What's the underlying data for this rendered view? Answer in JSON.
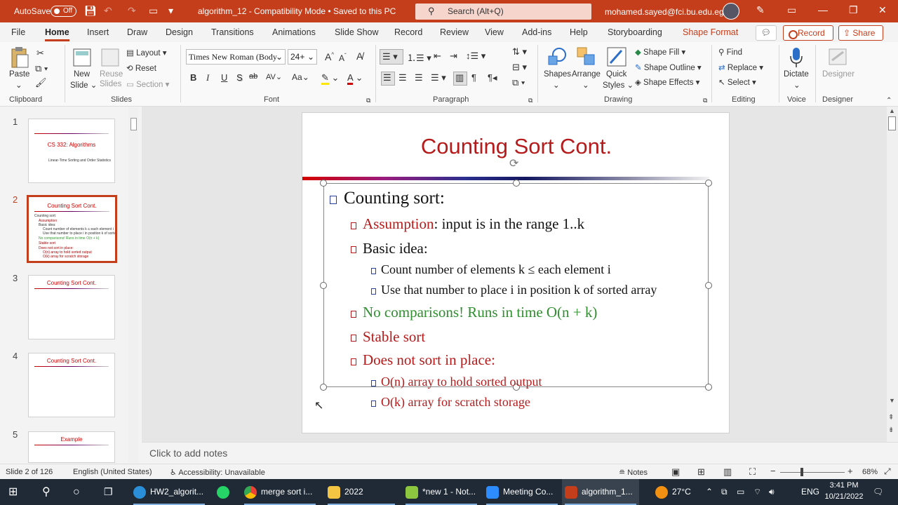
{
  "titlebar": {
    "autosave_label": "AutoSave",
    "autosave_state": "Off",
    "document": "algorithm_12  -  Compatibility Mode  •  Saved to this PC",
    "search_placeholder": "Search (Alt+Q)",
    "user_email": "mohamed.sayed@fci.bu.edu.eg"
  },
  "menu": {
    "tabs": [
      "File",
      "Home",
      "Insert",
      "Draw",
      "Design",
      "Transitions",
      "Animations",
      "Slide Show",
      "Record",
      "Review",
      "View",
      "Add-ins",
      "Help",
      "Storyboarding",
      "Shape Format"
    ],
    "active": "Home",
    "record_label": "Record",
    "share_label": "Share"
  },
  "ribbon": {
    "clipboard": {
      "paste": "Paste",
      "label": "Clipboard"
    },
    "slides": {
      "new_slide": "New",
      "new_slide2": "Slide",
      "reuse": "Reuse",
      "reuse2": "Slides",
      "layout": "Layout",
      "reset": "Reset",
      "section": "Section",
      "label": "Slides"
    },
    "font": {
      "name": "Times New Roman (Body",
      "size": "24+",
      "label": "Font",
      "bold": "B",
      "italic": "I",
      "underline": "U",
      "shadow": "S",
      "strike": "ab",
      "spacing": "AV",
      "case": "Aa",
      "grow": "A",
      "shrink": "A"
    },
    "paragraph": {
      "label": "Paragraph"
    },
    "drawing": {
      "shapes": "Shapes",
      "arrange": "Arrange",
      "quick": "Quick",
      "quick2": "Styles",
      "fill": "Shape Fill",
      "outline": "Shape Outline",
      "effects": "Shape Effects",
      "label": "Drawing"
    },
    "editing": {
      "find": "Find",
      "replace": "Replace",
      "select": "Select",
      "label": "Editing"
    },
    "voice": {
      "dictate": "Dictate",
      "label": "Voice"
    },
    "designer": {
      "designer": "Designer",
      "label": "Designer"
    }
  },
  "thumbnails": [
    {
      "num": "1",
      "title": "CS 332: Algorithms",
      "sub": "Linear-Time Sorting and Order Statistics"
    },
    {
      "num": "2",
      "title": "Counting Sort Cont."
    },
    {
      "num": "3",
      "title": "Counting Sort Cont."
    },
    {
      "num": "4",
      "title": "Counting Sort Cont."
    },
    {
      "num": "5",
      "title": "Example"
    }
  ],
  "slide": {
    "title": "Counting Sort Cont.",
    "b1": "Counting sort:",
    "b2a": "Assumption",
    "b2b": ": input is in the range 1..k",
    "b3": "Basic idea:",
    "b4": "Count number of elements k ≤ each element i",
    "b5": "Use that number to place i in position k of sorted array",
    "b6": "No comparisons! Runs in time O(n + k)",
    "b7": "Stable sort",
    "b8": "Does not sort in place:",
    "b9": "O(n) array to hold sorted output",
    "b10": "O(k) array for scratch storage"
  },
  "notes_placeholder": "Click to add notes",
  "status": {
    "slide": "Slide 2 of 126",
    "lang": "English (United States)",
    "access": "Accessibility: Unavailable",
    "notes": "Notes",
    "zoom": "68%"
  },
  "taskbar": {
    "items": [
      "HW2_algorit...",
      "merge sort i...",
      "2022",
      "*new 1 - Not...",
      "Meeting Co...",
      "algorithm_1..."
    ],
    "weather": "27°C",
    "lang": "ENG",
    "time": "3:41 PM",
    "date": "10/21/2022"
  },
  "colors": {
    "accent": "#c43e1c",
    "title_red": "#b51b1b",
    "green": "#2f8f2f"
  }
}
